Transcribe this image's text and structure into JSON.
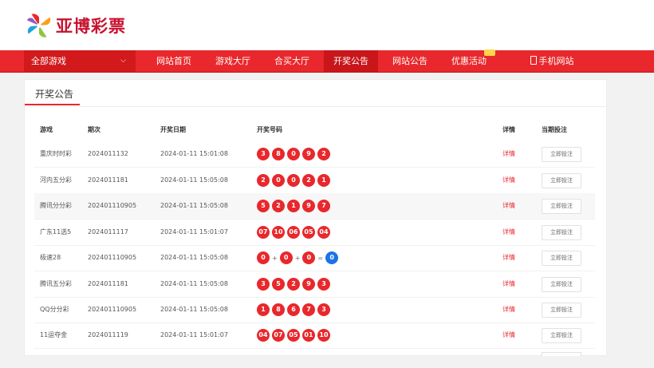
{
  "brand": {
    "name": "亚博彩票"
  },
  "nav": {
    "all_games": "全部游戏",
    "items": [
      "网站首页",
      "游戏大厅",
      "合买大厅",
      "开奖公告",
      "网站公告",
      "优惠活动",
      "手机网站"
    ]
  },
  "panel": {
    "title": "开奖公告",
    "headers": [
      "游戏",
      "期次",
      "开奖日期",
      "开奖号码",
      "详情",
      "当期投注"
    ],
    "rows": [
      {
        "game": "重庆时时彩",
        "issue": "2024011132",
        "date": "2024-01-11 15:01:08",
        "numbers": [
          "3",
          "8",
          "0",
          "9",
          "2"
        ],
        "detail": "详情",
        "bet": "立即投注"
      },
      {
        "game": "河内五分彩",
        "issue": "2024011181",
        "date": "2024-01-11 15:05:08",
        "numbers": [
          "2",
          "0",
          "0",
          "2",
          "1"
        ],
        "detail": "详情",
        "bet": "立即投注"
      },
      {
        "game": "腾讯分分彩",
        "issue": "202401110905",
        "date": "2024-01-11 15:05:08",
        "numbers": [
          "5",
          "2",
          "1",
          "9",
          "7"
        ],
        "detail": "详情",
        "bet": "立即投注"
      },
      {
        "game": "广东11选5",
        "issue": "2024011117",
        "date": "2024-01-11 15:01:07",
        "numbers": [
          "07",
          "10",
          "06",
          "05",
          "04"
        ],
        "detail": "详情",
        "bet": "立即投注"
      },
      {
        "game": "极速28",
        "issue": "202401110905",
        "date": "2024-01-11 15:05:08",
        "numbers": [
          "0",
          "0",
          "0"
        ],
        "sum": "0",
        "detail": "详情",
        "bet": "立即投注"
      },
      {
        "game": "腾讯五分彩",
        "issue": "2024011181",
        "date": "2024-01-11 15:05:08",
        "numbers": [
          "3",
          "5",
          "2",
          "9",
          "3"
        ],
        "detail": "详情",
        "bet": "立即投注"
      },
      {
        "game": "QQ分分彩",
        "issue": "202401110905",
        "date": "2024-01-11 15:05:08",
        "numbers": [
          "1",
          "8",
          "6",
          "7",
          "3"
        ],
        "detail": "详情",
        "bet": "立即投注"
      },
      {
        "game": "11运夺金",
        "issue": "2024011119",
        "date": "2024-01-11 15:01:07",
        "numbers": [
          "04",
          "07",
          "05",
          "01",
          "10"
        ],
        "detail": "详情",
        "bet": "立即投注"
      }
    ]
  },
  "colors": {
    "accent": "#e8282c",
    "blue_ball": "#1a73e8"
  }
}
